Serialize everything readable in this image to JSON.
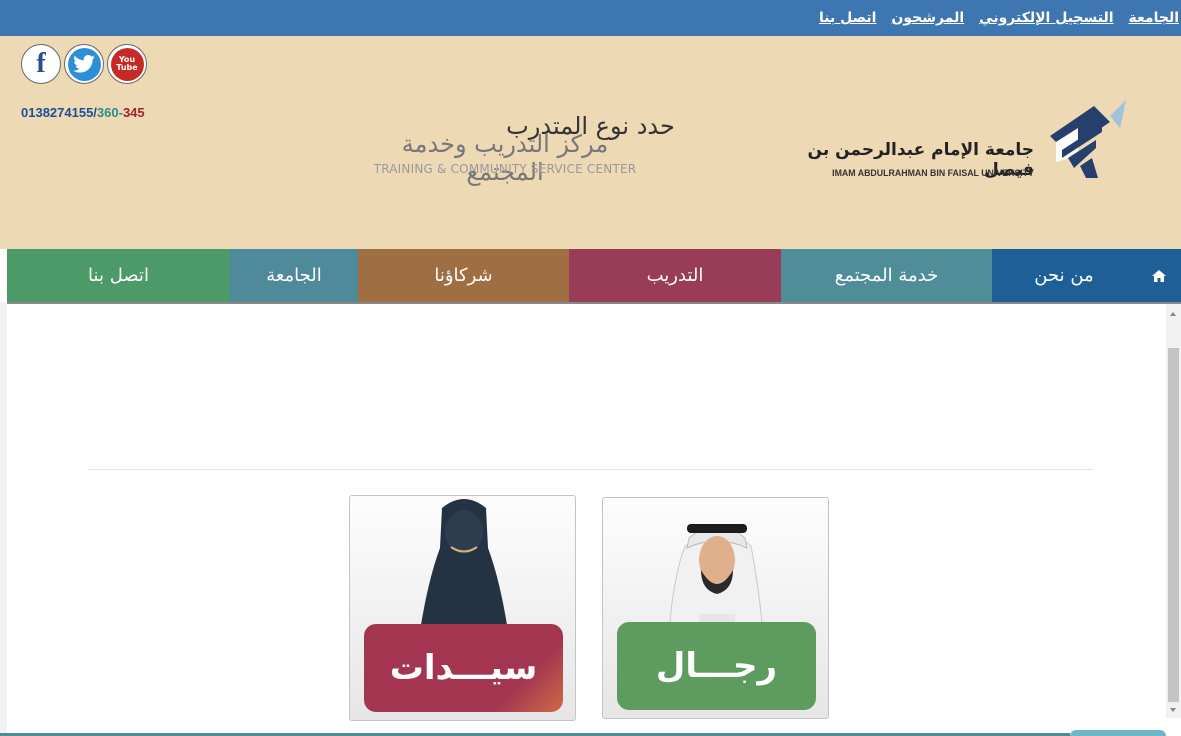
{
  "top_links": [
    "الجامعة",
    "التسجيل الإلكتروني",
    "المرشحون",
    "اتصل بنا"
  ],
  "social": [
    "facebook-icon",
    "twitter-icon",
    "youtube-icon"
  ],
  "youtube_text": {
    "line1": "You",
    "line2": "Tube"
  },
  "phone": {
    "part1": "0138274155/",
    "part2": "360-",
    "part3": "345"
  },
  "center": {
    "title_ar": "مركز التدريب وخدمة المجتمع",
    "title_en": "TRAINING & COMMUNITY SERVICE CENTER"
  },
  "university": {
    "name_ar": "جامعة الإمام عبدالرحمن بن فيصل",
    "name_en": "IMAM ABDULRAHMAN BIN FAISAL UNIVERSITY"
  },
  "nav": {
    "home_icon": "home-icon",
    "items": [
      "من نحن",
      "خدمة المجتمع",
      "التدريب",
      "شركاؤنا",
      "الجامعة",
      "اتصل بنا"
    ]
  },
  "main": {
    "heading": "حدد نوع المتدرب",
    "cards": [
      {
        "label": "رجـــال",
        "icon": "man-avatar-icon"
      },
      {
        "label": "سيـــدات",
        "icon": "woman-avatar-icon"
      }
    ]
  },
  "colors": {
    "top_bar": "#3d76b0",
    "header_bg": "#eed9b5",
    "nav": [
      "#1f5f98",
      "#4f8d99",
      "#983c57",
      "#a06e43",
      "#4f8a9a",
      "#4b9a68"
    ],
    "women_label": "#a43551",
    "men_label": "#5e9b5e",
    "phone_blue": "#1b4f93",
    "phone_teal": "#2b8c8c",
    "phone_red": "#a1222d"
  }
}
